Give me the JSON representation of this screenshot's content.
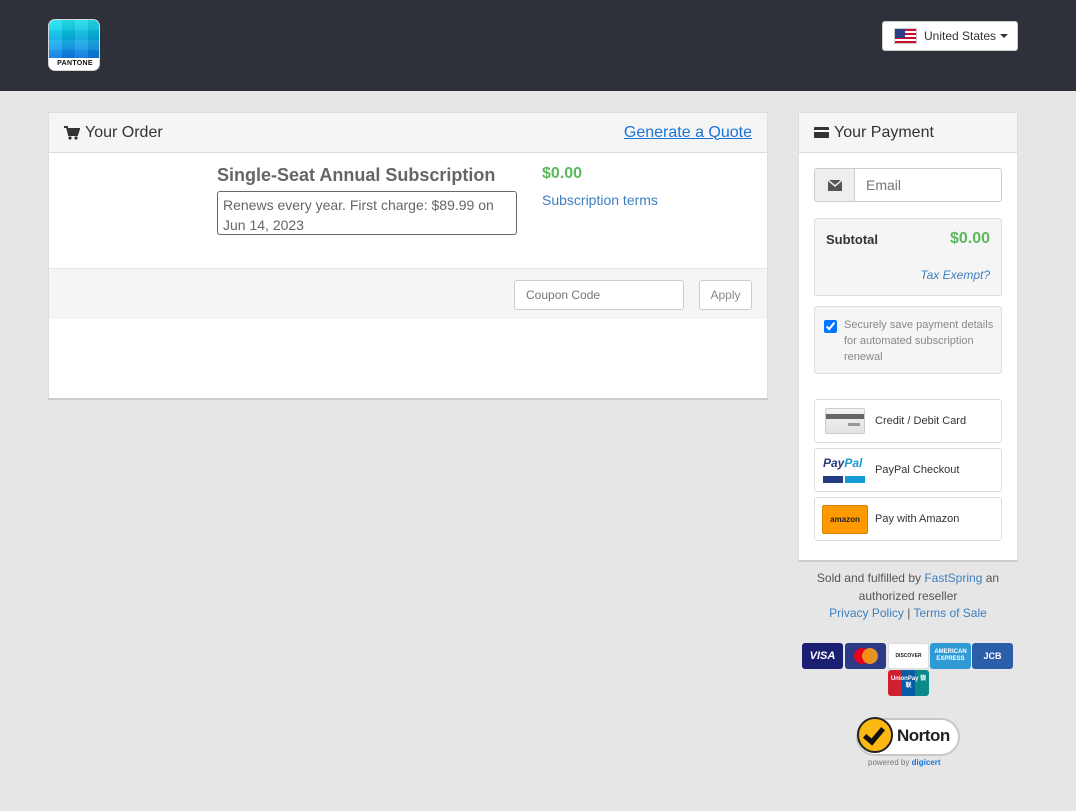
{
  "header": {
    "logo_text": "PANTONE",
    "country_selector": "United States"
  },
  "order": {
    "title": "Your Order",
    "generate_quote": "Generate a Quote",
    "item": {
      "name": "Single-Seat Annual Subscription",
      "renew_text": "Renews every year. First charge: $89.99 on Jun 14, 2023",
      "price": "$0.00",
      "terms_link": "Subscription terms"
    },
    "coupon": {
      "placeholder": "Coupon Code",
      "apply_label": "Apply"
    }
  },
  "payment": {
    "title": "Your Payment",
    "email_placeholder": "Email",
    "subtotal_label": "Subtotal",
    "subtotal_value": "$0.00",
    "tax_exempt": "Tax Exempt?",
    "save_details": "Securely save payment details for automated subscription renewal",
    "save_checked": true,
    "methods": [
      {
        "label": "Credit / Debit Card",
        "icon": "credit-card-icon"
      },
      {
        "label": "PayPal Checkout",
        "icon": "paypal-logo",
        "logo_text": "PayPal"
      },
      {
        "label": "Pay with Amazon",
        "icon": "amazon-logo",
        "logo_text": "amazon"
      }
    ]
  },
  "footer": {
    "sold_by_prefix": "Sold and fulfilled by",
    "fastspring": "FastSpring",
    "sold_by_suffix": "an authorized reseller",
    "privacy": "Privacy Policy",
    "separator": "|",
    "terms": "Terms of Sale"
  },
  "accepted_cards": [
    "VISA",
    "MasterCard",
    "DISCOVER",
    "AMERICAN EXPRESS",
    "JCB",
    "UnionPay 银联"
  ],
  "trust_badge": {
    "name": "Norton",
    "sub_prefix": "powered by",
    "sub_brand": "digicert"
  },
  "colors": {
    "header_bg": "#2e313a",
    "page_bg": "#e6e6e6",
    "price_green": "#5cb85c",
    "link_blue": "#3d7fc0"
  }
}
